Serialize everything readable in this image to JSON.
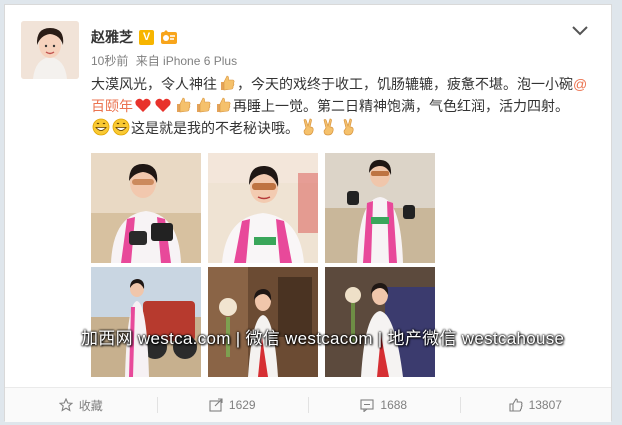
{
  "post": {
    "author": "赵雅芝",
    "verified_badge": "V",
    "time": "10秒前",
    "source": "来自 iPhone 6 Plus",
    "text": {
      "p1": "大漠风光，令人神往",
      "p2": "，今天的戏终于收工，饥肠辘辘，疲惫不堪。泡一小碗",
      "mention": "@百颐年",
      "p3": "再睡上一觉。第二日精神饱满，气色红润，活力四射。",
      "p4": "这是就是我的不老秘诀哦。"
    },
    "photos": [
      {
        "desc": "racing-suit-gloves-1"
      },
      {
        "desc": "racing-suit-sunglasses"
      },
      {
        "desc": "racing-suit-desert"
      },
      {
        "desc": "racing-suit-with-truck"
      },
      {
        "desc": "white-red-gown-1"
      },
      {
        "desc": "white-red-gown-2"
      }
    ]
  },
  "watermark": "加西网 westca.com | 微信 westcacom | 地产微信 westcahouse",
  "actions": {
    "favorite": "收藏",
    "repost": "1629",
    "comment": "1688",
    "like": "13807"
  },
  "icons": [
    "avatar",
    "chevron-down-icon",
    "verified-icon",
    "member-badge-icon",
    "thumbs-up-emoji-icon",
    "heart-emoji-icon",
    "grin-emoji-icon",
    "victory-hand-emoji-icon",
    "star-icon",
    "share-icon",
    "comment-icon",
    "like-icon"
  ],
  "colors": {
    "mention": "#eb7350",
    "badge": "#f7b500",
    "muted": "#808080"
  }
}
